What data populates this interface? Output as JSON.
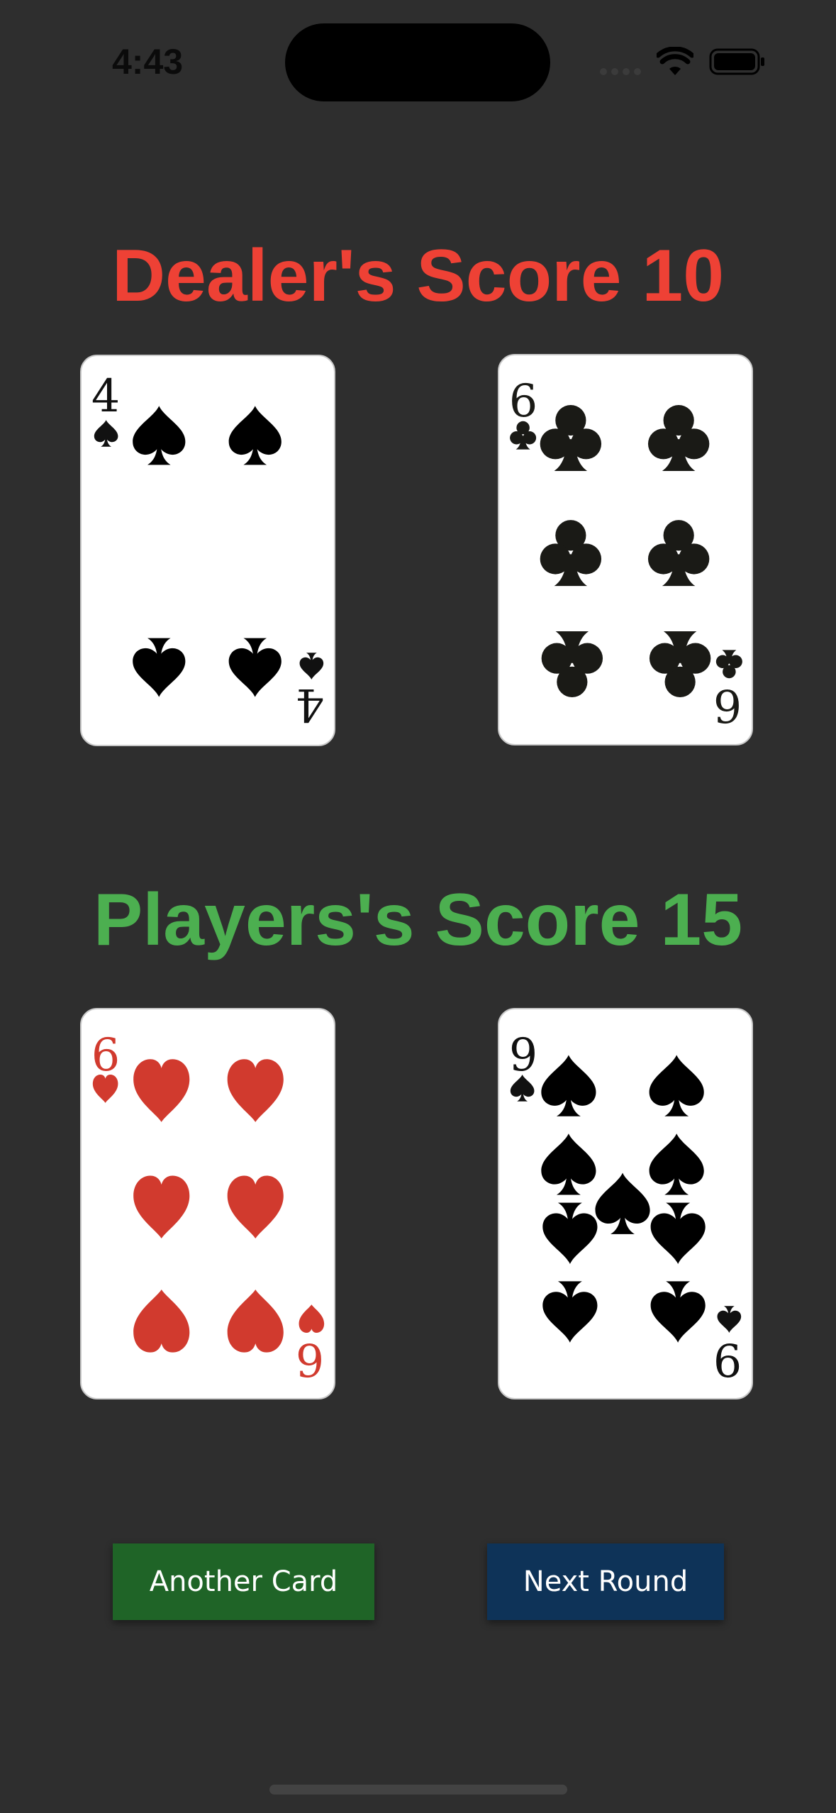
{
  "status_bar": {
    "time": "4:43",
    "icons": [
      "signal-dots-icon",
      "wifi-icon",
      "battery-icon"
    ]
  },
  "dealer": {
    "score_text": "Dealer's Score 10",
    "cards": [
      {
        "rank": "4",
        "suit": "spades",
        "color": "#111111"
      },
      {
        "rank": "6",
        "suit": "clubs",
        "color": "#1a1a16"
      }
    ]
  },
  "player": {
    "score_text": "Players's Score 15",
    "cards": [
      {
        "rank": "6",
        "suit": "hearts",
        "color": "#d13a2e"
      },
      {
        "rank": "9",
        "suit": "spades",
        "color": "#111111"
      }
    ]
  },
  "actions": {
    "another_card_label": "Another Card",
    "next_round_label": "Next Round"
  },
  "colors": {
    "background": "#2e2e2e",
    "dealer_score": "#ee4135",
    "player_score": "#4caf50",
    "another_card_button": "#1f6427",
    "next_round_button": "#0e3358"
  }
}
